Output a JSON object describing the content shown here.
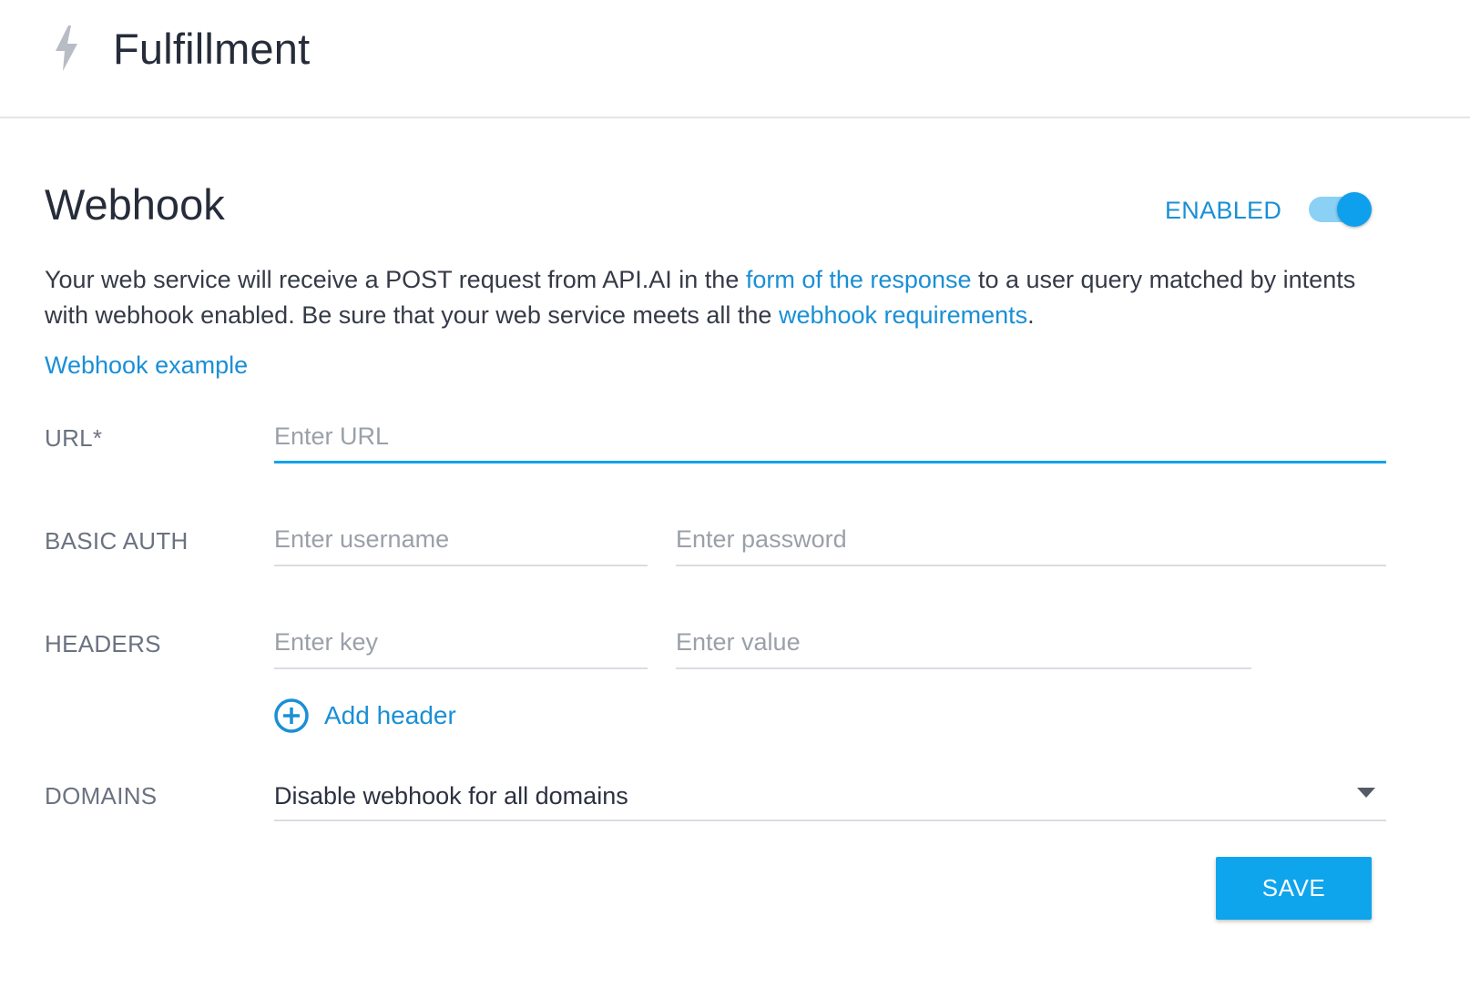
{
  "header": {
    "icon": "lightning-bolt-icon",
    "title": "Fulfillment"
  },
  "webhook": {
    "title": "Webhook",
    "status_label": "ENABLED",
    "enabled": true,
    "description": {
      "part1": "Your web service will receive a POST request from API.AI in the ",
      "link1": "form of the response",
      "part2": " to a user query matched by intents with webhook enabled. Be sure that your web service meets all the ",
      "link2": "webhook requirements",
      "part3": "."
    },
    "example_link": "Webhook example"
  },
  "form": {
    "url": {
      "label": "URL*",
      "value": "",
      "placeholder": "Enter URL"
    },
    "basic_auth": {
      "label": "BASIC AUTH",
      "username_value": "",
      "username_placeholder": "Enter username",
      "password_value": "",
      "password_placeholder": "Enter password"
    },
    "headers": {
      "label": "HEADERS",
      "key_value": "",
      "key_placeholder": "Enter key",
      "value_value": "",
      "value_placeholder": "Enter value",
      "add_label": "Add header",
      "add_icon": "plus-circle-icon"
    },
    "domains": {
      "label": "DOMAINS",
      "selected": "Disable webhook for all domains",
      "arrow_icon": "dropdown-arrow-icon"
    }
  },
  "actions": {
    "save_label": "SAVE"
  },
  "colors": {
    "accent": "#1a8fd6",
    "primary_button": "#0ea5ec",
    "toggle_track": "#8ad1f5",
    "toggle_knob": "#0ea0ec",
    "title_text": "#262c3a",
    "label_text": "#6b7280"
  }
}
